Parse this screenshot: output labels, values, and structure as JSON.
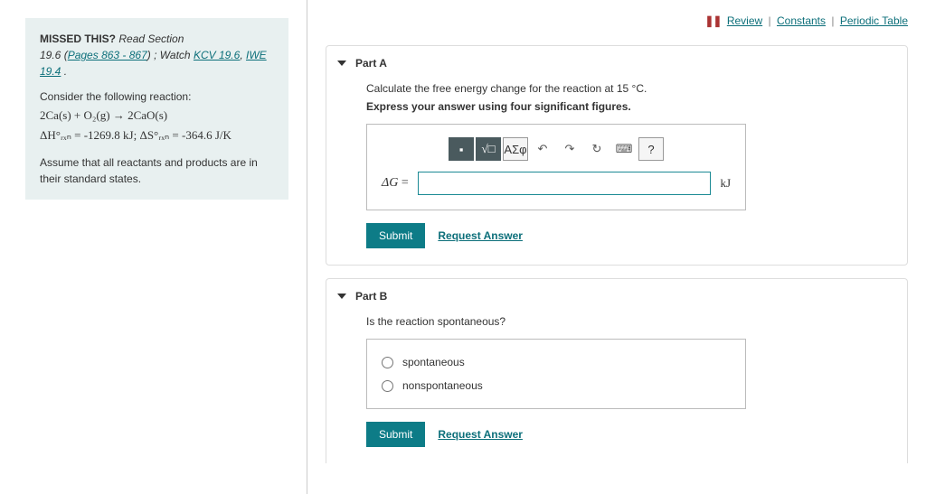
{
  "top_links": {
    "review": "Review",
    "constants": "Constants",
    "periodic": "Periodic Table"
  },
  "hint": {
    "missed_label": "MISSED THIS?",
    "read_section": "Read Section",
    "sec_num": "19.6",
    "pages_link": "Pages 863 - 867",
    "watch": "; Watch",
    "kcv_link": "KCV 19.6",
    "iwe_link": "IWE 19.4",
    "period": " .",
    "consider": "Consider the following reaction:",
    "reaction": "2Ca(s) + O₂(g) → 2CaO(s)",
    "thermo": "ΔH°ᵣₓₙ = -1269.8 kJ;  ΔS°ᵣₓₙ = -364.6 J/K",
    "assume": "Assume that all reactants and products are in their standard states."
  },
  "partA": {
    "title": "Part A",
    "prompt": "Calculate the free energy change for the reaction at 15 °C.",
    "express": "Express your answer using four significant figures.",
    "toolbar_greek": "ΑΣφ",
    "dg_label": "ΔG =",
    "unit": "kJ",
    "submit": "Submit",
    "request": "Request Answer"
  },
  "partB": {
    "title": "Part B",
    "prompt": "Is the reaction spontaneous?",
    "opt1": "spontaneous",
    "opt2": "nonspontaneous",
    "submit": "Submit",
    "request": "Request Answer"
  }
}
